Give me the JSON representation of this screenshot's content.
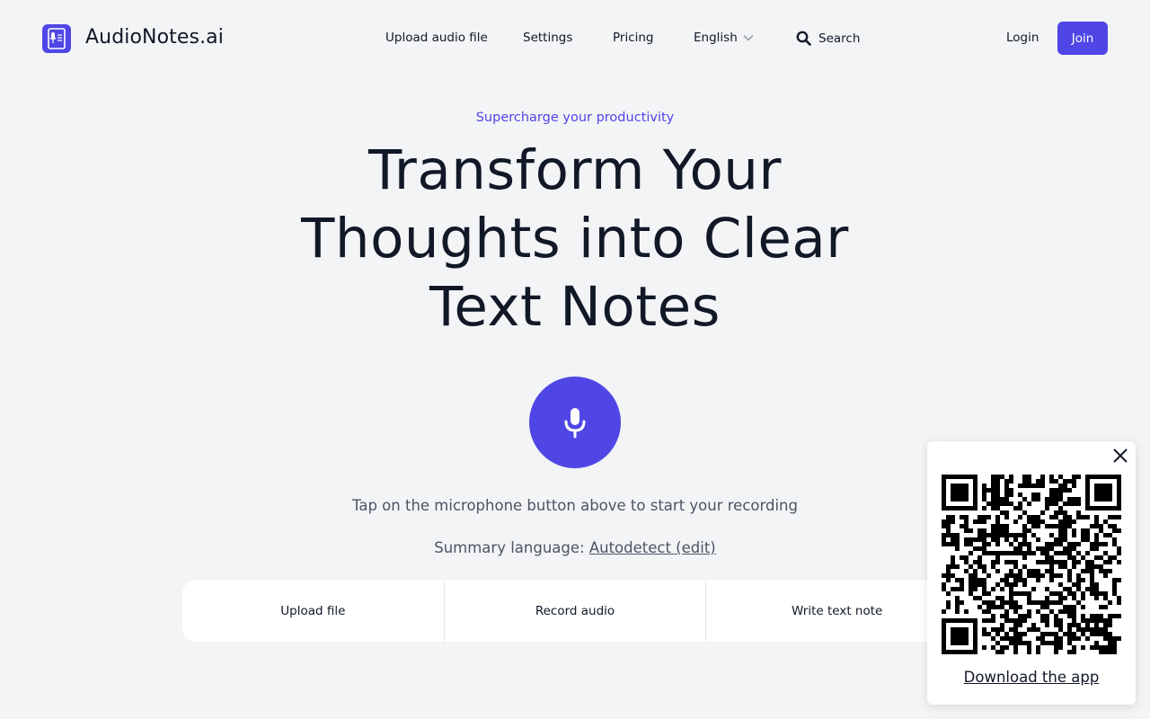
{
  "header": {
    "brand": "AudioNotes.ai",
    "nav": {
      "upload": "Upload audio file",
      "settings": "Settings",
      "pricing": "Pricing",
      "language": "English",
      "search": "Search"
    },
    "login": "Login",
    "join": "Join"
  },
  "hero": {
    "tagline": "Supercharge your productivity",
    "headline": "Transform Your Thoughts into Clear Text Notes",
    "hint": "Tap on the microphone button above to start your recording",
    "summary_label": "Summary language: ",
    "summary_value": "Autodetect (edit)"
  },
  "actions": {
    "upload": "Upload file",
    "record": "Record audio",
    "write": "Write text note"
  },
  "qr_popup": {
    "link": "Download the app"
  },
  "colors": {
    "accent": "#4f46e5",
    "background": "#f3f4f6",
    "text": "#111827",
    "muted": "#4b5563"
  },
  "icons": [
    "app-logo-icon",
    "chevron-down-icon",
    "search-icon",
    "microphone-icon",
    "close-icon",
    "qr-code-icon"
  ]
}
